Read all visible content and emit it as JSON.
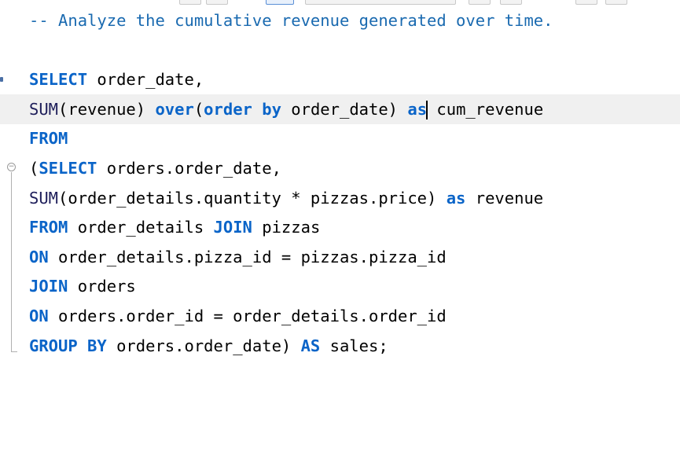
{
  "colors": {
    "keyword": "#0a64c8",
    "comment": "#1a6ab0",
    "text": "#000000",
    "current_line": "#f0f0f0"
  },
  "editor": {
    "lines": [
      {
        "tokens": [
          {
            "t": "-- Analyze the cumulative revenue generated over time.",
            "k": "cm"
          }
        ]
      },
      {
        "tokens": []
      },
      {
        "tokens": [
          {
            "t": "SELECT",
            "k": "kw"
          },
          {
            "t": " order_date,",
            "k": ""
          }
        ]
      },
      {
        "tokens": [
          {
            "t": "SUM",
            "k": "fn"
          },
          {
            "t": "(revenue) ",
            "k": ""
          },
          {
            "t": "over",
            "k": "kw"
          },
          {
            "t": "(",
            "k": ""
          },
          {
            "t": "order by",
            "k": "kw"
          },
          {
            "t": " order_date) ",
            "k": ""
          },
          {
            "t": "as",
            "k": "kw"
          },
          {
            "t": " cum_revenue",
            "k": ""
          }
        ]
      },
      {
        "tokens": [
          {
            "t": "FROM",
            "k": "kw"
          }
        ]
      },
      {
        "tokens": [
          {
            "t": "(",
            "k": ""
          },
          {
            "t": "SELECT",
            "k": "kw"
          },
          {
            "t": " orders.order_date,",
            "k": ""
          }
        ]
      },
      {
        "tokens": [
          {
            "t": "SUM",
            "k": "fn"
          },
          {
            "t": "(order_details.quantity * pizzas.price) ",
            "k": ""
          },
          {
            "t": "as",
            "k": "kw"
          },
          {
            "t": " revenue",
            "k": ""
          }
        ]
      },
      {
        "tokens": [
          {
            "t": "FROM",
            "k": "kw"
          },
          {
            "t": " order_details ",
            "k": ""
          },
          {
            "t": "JOIN",
            "k": "kw"
          },
          {
            "t": " pizzas",
            "k": ""
          }
        ]
      },
      {
        "tokens": [
          {
            "t": "ON",
            "k": "kw"
          },
          {
            "t": " order_details.pizza_id = pizzas.pizza_id",
            "k": ""
          }
        ]
      },
      {
        "tokens": [
          {
            "t": "JOIN",
            "k": "kw"
          },
          {
            "t": " orders",
            "k": ""
          }
        ]
      },
      {
        "tokens": [
          {
            "t": "ON",
            "k": "kw"
          },
          {
            "t": " orders.order_id = order_details.order_id",
            "k": ""
          }
        ]
      },
      {
        "tokens": [
          {
            "t": "GROUP BY",
            "k": "kw"
          },
          {
            "t": " orders.order_date) ",
            "k": ""
          },
          {
            "t": "AS",
            "k": "kw"
          },
          {
            "t": " sales;",
            "k": ""
          }
        ]
      }
    ],
    "current_line_index": 3,
    "caret": {
      "line": 3,
      "token": 6,
      "char": 6
    },
    "fold_start_line": 5,
    "fold_end_line": 11,
    "statement_marker_line": 2
  }
}
